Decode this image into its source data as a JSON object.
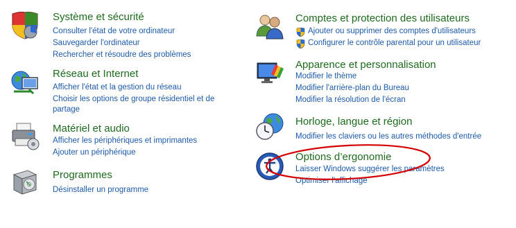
{
  "left": [
    {
      "id": "security",
      "icon": "shield-icon",
      "title": "Système et sécurité",
      "links": [
        "Consulter l'état de votre ordinateur",
        "Sauvegarder l'ordinateur",
        "Rechercher et résoudre des problèmes"
      ]
    },
    {
      "id": "network",
      "icon": "network-globe-icon",
      "title": "Réseau et Internet",
      "links": [
        "Afficher l'état et la gestion du réseau",
        "Choisir les options de groupe résidentiel et de partage"
      ]
    },
    {
      "id": "hardware",
      "icon": "printer-icon",
      "title": "Matériel et audio",
      "links": [
        "Afficher les périphériques et imprimantes",
        "Ajouter un périphérique"
      ]
    },
    {
      "id": "programs",
      "icon": "programs-box-icon",
      "title": "Programmes",
      "links": [
        "Désinstaller un programme"
      ]
    }
  ],
  "right": [
    {
      "id": "accounts",
      "icon": "users-icon",
      "title": "Comptes et protection des utilisateurs",
      "links": [
        "Ajouter ou supprimer des comptes d'utilisateurs",
        "Configurer le contrôle parental pour un utilisateur"
      ]
    },
    {
      "id": "appearance",
      "icon": "monitor-brush-icon",
      "title": "Apparence et personnalisation",
      "links": [
        "Modifier le thème",
        "Modifier l'arrière-plan du Bureau",
        "Modifier la résolution de l'écran"
      ]
    },
    {
      "id": "clock",
      "icon": "clock-globe-icon",
      "title": "Horloge, langue et région",
      "links": [
        "Modifier les claviers ou les autres méthodes d'entrée"
      ]
    },
    {
      "id": "ease",
      "icon": "ease-of-access-icon",
      "title": "Options d’ergonomie",
      "links": [
        "Laisser Windows suggérer les paramètres",
        "Optimiser l'affichage"
      ]
    }
  ],
  "colors": {
    "title": "#1e6a1e",
    "link": "#1e5aa8",
    "annotation": "#d40000"
  }
}
